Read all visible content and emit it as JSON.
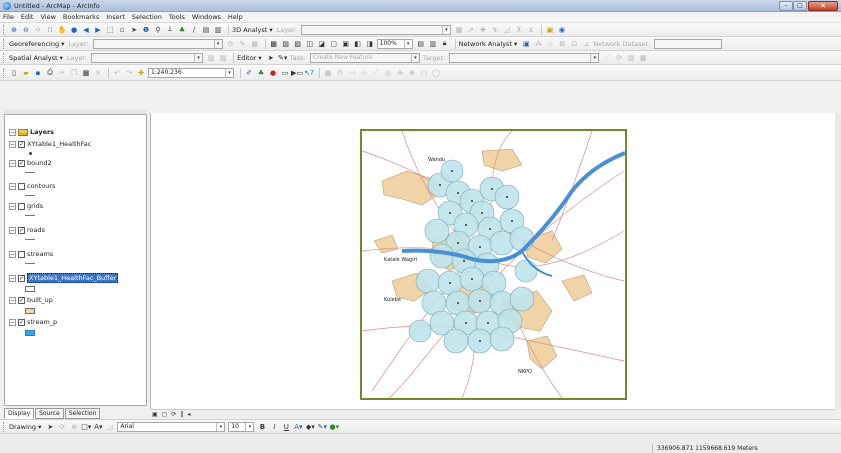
{
  "window": {
    "title": "Untitled - ArcMap - ArcInfo",
    "close_glyph": "✕",
    "minimize_glyph": "–",
    "maximize_glyph": "□"
  },
  "menu": [
    "File",
    "Edit",
    "View",
    "Bookmarks",
    "Insert",
    "Selection",
    "Tools",
    "Windows",
    "Help"
  ],
  "toolbar1": {
    "analyst_3d": "3D Analyst ▾",
    "layer_label": "Layer:"
  },
  "toolbar2": {
    "georeferencing": "Georeferencing ▾",
    "layer_label": "Layer:",
    "zoom_percent": "100%",
    "network_analyst": "Network Analyst ▾",
    "network_dataset": "Network Dataset:"
  },
  "toolbar3": {
    "spatial_analyst": "Spatial Analyst ▾",
    "layer_label": "Layer:",
    "editor": "Editor ▾",
    "task_label": "Task:",
    "task_value": "Create New Feature",
    "target_label": "Target:"
  },
  "toolbar4": {
    "scale": "1:240,236"
  },
  "toc": {
    "root": "Layers",
    "layers": [
      {
        "name": "XYtable1_HealthFac",
        "checked": true
      },
      {
        "name": "bound2",
        "checked": true
      },
      {
        "name": "contours",
        "checked": false
      },
      {
        "name": "grids",
        "checked": false
      },
      {
        "name": "roads",
        "checked": true
      },
      {
        "name": "streams",
        "checked": false
      },
      {
        "name": "XYtable1_HealthFac_Buffer",
        "checked": true,
        "selected": true
      },
      {
        "name": "built_up",
        "checked": true
      },
      {
        "name": "stream_p",
        "checked": true
      }
    ],
    "tabs": [
      "Display",
      "Source",
      "Selection"
    ]
  },
  "map_labels": {
    "wandu": "Wandu",
    "katale_wagiri": "Katale Wagiri",
    "kulebe": "Kulebe",
    "nkpo": "NKPO"
  },
  "drawing": {
    "menu": "Drawing ▾",
    "font": "Arial",
    "font_size": "10"
  },
  "status": {
    "coordinates": "336906.871  1159668.619 Meters"
  },
  "colors": {
    "river": "#4a8fd6",
    "built_up": "#f1d3a8",
    "buffer": "#bfe3ea",
    "roads": "#d98a8a",
    "selection": "#3b73c8"
  }
}
